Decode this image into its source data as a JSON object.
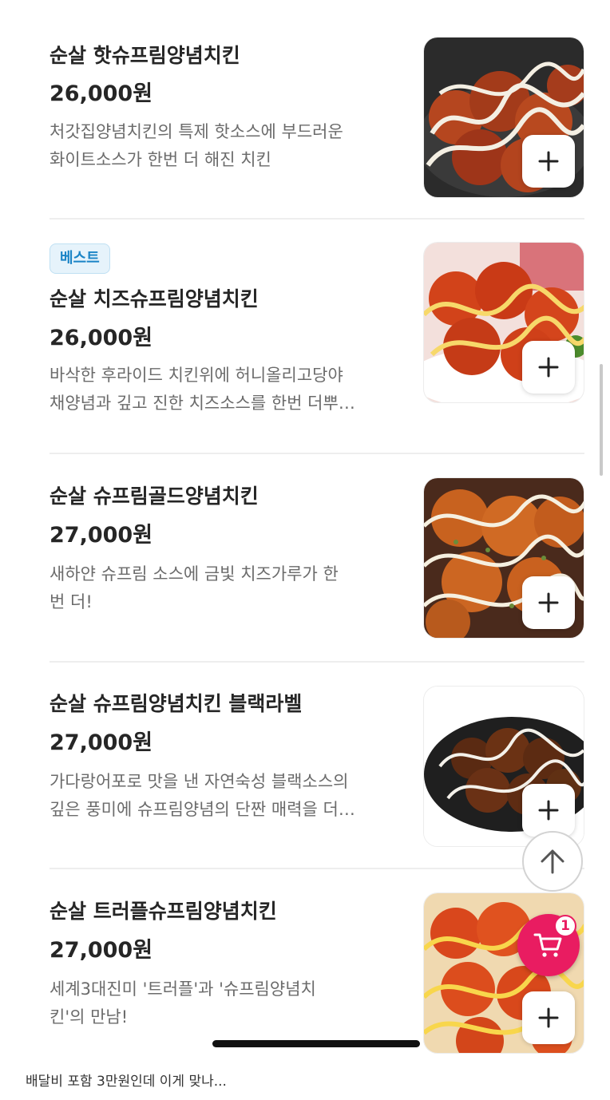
{
  "menu": {
    "items": [
      {
        "name": "순살 핫슈프림양념치킨",
        "price": "26,000원",
        "badge": "",
        "description_lines": [
          "처갓집양념치킨의 특제 핫소스에 부드러운",
          "화이트소스가 한번 더 해진 치킨"
        ],
        "add_icon": "plus-icon"
      },
      {
        "name": "순살 치즈슈프림양념치킨",
        "price": "26,000원",
        "badge": "베스트",
        "description_lines": [
          "바삭한 후라이드 치킨위에 허니올리고당야",
          "채양념과 깊고 진한 치즈소스를 한번 더뿌…"
        ],
        "add_icon": "plus-icon"
      },
      {
        "name": "순살 슈프림골드양념치킨",
        "price": "27,000원",
        "badge": "",
        "description_lines": [
          "새하얀 슈프림 소스에 금빛 치즈가루가 한",
          "번 더!"
        ],
        "add_icon": "plus-icon"
      },
      {
        "name": "순살 슈프림양념치킨 블랙라벨",
        "price": "27,000원",
        "badge": "",
        "description_lines": [
          "가다랑어포로 맛을 낸 자연숙성 블랙소스의",
          "깊은 풍미에 슈프림양념의 단짠 매력을 더…"
        ],
        "add_icon": "plus-icon"
      },
      {
        "name": "순살 트러플슈프림양념치킨",
        "price": "27,000원",
        "badge": "",
        "description_lines": [
          "세계3대진미 '트러플'과 '슈프림양념치",
          "킨'의 만남!"
        ],
        "add_icon": "plus-icon"
      }
    ]
  },
  "floating": {
    "scroll_top_icon": "arrow-up-icon",
    "cart_icon": "cart-icon",
    "cart_count": "1"
  },
  "caption": "배달비 포함 3만원인데 이게 맞나...",
  "colors": {
    "accent": "#e91c61",
    "badge_text": "#1a84c6",
    "badge_bg": "#e6f3fb"
  }
}
